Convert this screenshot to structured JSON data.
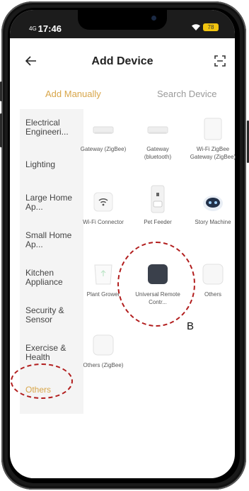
{
  "status_bar": {
    "signal": "4G",
    "time": "17:46",
    "battery": "78"
  },
  "header": {
    "title": "Add Device"
  },
  "tabs": [
    {
      "label": "Add Manually"
    },
    {
      "label": "Search Device"
    }
  ],
  "categories": [
    {
      "label": "Electrical Engineeri..."
    },
    {
      "label": "Lighting"
    },
    {
      "label": "Large Home Ap..."
    },
    {
      "label": "Small Home Ap..."
    },
    {
      "label": "Kitchen Appliance"
    },
    {
      "label": "Security & Sensor"
    },
    {
      "label": "Exercise & Health"
    },
    {
      "label": "Others"
    }
  ],
  "devices": [
    {
      "label": "Gateway (ZigBee)",
      "icon": "gateway-icon"
    },
    {
      "label": "Gateway (bluetooth)",
      "icon": "gateway-icon"
    },
    {
      "label": "Wi-Fi ZigBee Gateway (ZigBee)",
      "icon": "box-icon"
    },
    {
      "label": "Wi-Fi Connector",
      "icon": "wifi-icon"
    },
    {
      "label": "Pet Feeder",
      "icon": "pet-feeder-icon"
    },
    {
      "label": "Story Machine",
      "icon": "robot-icon"
    },
    {
      "label": "Plant Grower",
      "icon": "plant-pot-icon"
    },
    {
      "label": "Universal Remote Contr...",
      "icon": "remote-icon"
    },
    {
      "label": "Others",
      "icon": "box-icon"
    },
    {
      "label": "Others (ZigBee)",
      "icon": "box-icon"
    }
  ],
  "annotations": {
    "letter": "B"
  },
  "colors": {
    "accent": "#d8a64a",
    "annotation": "#b21d1d"
  }
}
